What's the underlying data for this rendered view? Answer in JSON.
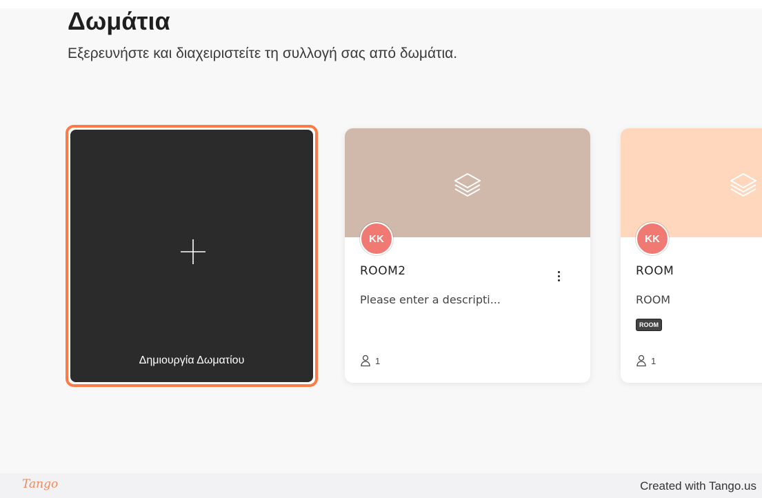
{
  "header": {
    "title": "Δωμάτια",
    "subtitle": "Εξερευνήστε και διαχειριστείτε τη συλλογή σας από δωμάτια."
  },
  "create_card": {
    "label": "Δημιουργία Δωματίου",
    "icon": "plus-icon",
    "highlight_color": "#ff7a45"
  },
  "rooms": [
    {
      "banner_color": "#d0b8ab",
      "icon": "layers-icon",
      "avatar_initials": "KK",
      "name": "ROOM2",
      "description": "Please enter a descripti...",
      "members": "1",
      "has_menu": true
    },
    {
      "banner_color": "#ffd7bd",
      "icon": "layers-icon",
      "avatar_initials": "KK",
      "name": "ROOM",
      "description": "ROOM",
      "tag": "ROOM",
      "members": "1"
    }
  ],
  "footer": {
    "brand": "Tango",
    "credit": "Created with Tango.us"
  }
}
